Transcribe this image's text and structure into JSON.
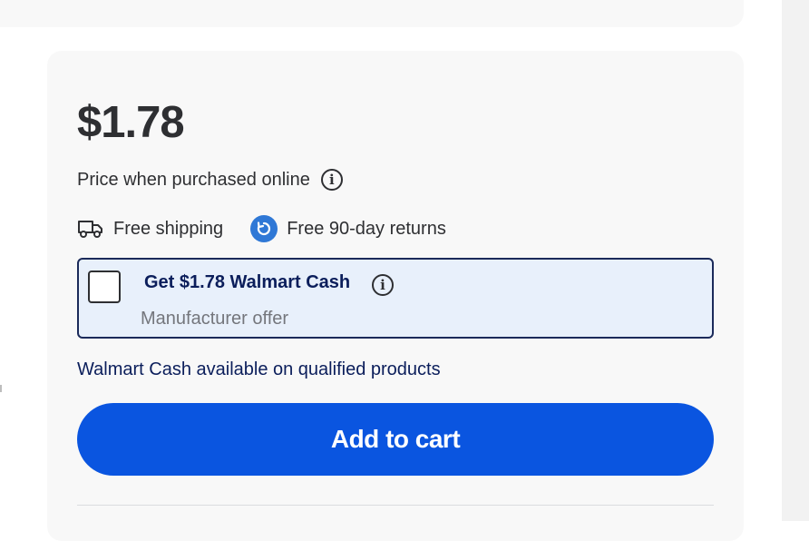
{
  "product": {
    "price": "$1.78",
    "price_note": "Price when purchased online"
  },
  "fulfillment": {
    "shipping_label": "Free shipping",
    "returns_label": "Free 90-day returns"
  },
  "offer": {
    "title": "Get $1.78 Walmart Cash",
    "subtitle": "Manufacturer offer",
    "checked": false
  },
  "cash_link": "Walmart Cash available on qualified products",
  "add_to_cart_label": "Add to cart",
  "icons": {
    "info": "info-icon",
    "shipping": "truck-icon",
    "returns": "returns-icon"
  },
  "colors": {
    "accent": "#0a55e0",
    "navy": "#0b1e5b",
    "offer_bg": "#e8f0fb",
    "returns_icon": "#2f78d6"
  }
}
